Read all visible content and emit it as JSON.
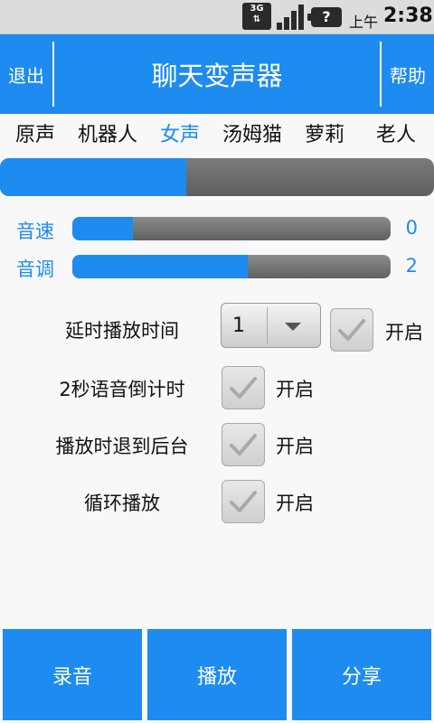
{
  "status_bar": {
    "network_type": "3G",
    "ampm": "上午",
    "time": "2:38",
    "battery_symbol": "?"
  },
  "titlebar": {
    "exit_label": "退出",
    "title": "聊天变声器",
    "help_label": "帮助"
  },
  "voice_tabs": {
    "items": [
      {
        "label": "原声"
      },
      {
        "label": "机器人"
      },
      {
        "label": "女声"
      },
      {
        "label": "汤姆猫"
      },
      {
        "label": "萝莉"
      },
      {
        "label": "老人"
      }
    ],
    "selected": "女声"
  },
  "main_progress": {
    "fraction": 0.43
  },
  "sliders": {
    "speed": {
      "label": "音速",
      "value": "0",
      "fill_fraction": 0.19
    },
    "pitch": {
      "label": "音调",
      "value": "2",
      "fill_fraction": 0.55
    }
  },
  "options": {
    "delay": {
      "label": "延时播放时间",
      "dropdown_value": "1",
      "state_label": "开启",
      "checked": true
    },
    "countdown": {
      "label": "2秒语音倒计时",
      "state_label": "开启",
      "checked": true
    },
    "background": {
      "label": "播放时退到后台",
      "state_label": "开启",
      "checked": true
    },
    "loop": {
      "label": "循环播放",
      "state_label": "开启",
      "checked": true
    }
  },
  "bottom_buttons": {
    "record": "录音",
    "play": "播放",
    "share": "分享"
  },
  "colors": {
    "accent": "#1e8bf1",
    "bar_gray": "#6a6c6c",
    "background": "#f8f8f8"
  }
}
